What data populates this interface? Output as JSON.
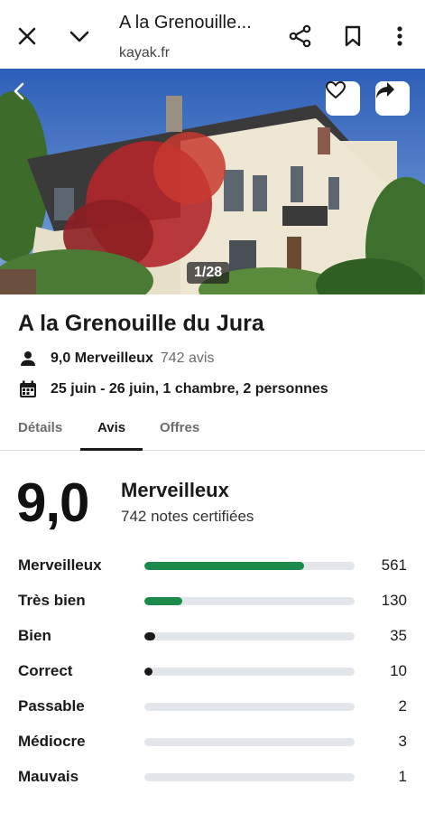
{
  "browser": {
    "title": "A la Grenouille...",
    "url": "kayak.fr",
    "icons": [
      "close-icon",
      "chevron-down-icon",
      "share-icon",
      "bookmark-icon",
      "more-vert-icon"
    ]
  },
  "hero": {
    "counter": "1/28",
    "icons": [
      "back-icon",
      "heart-icon",
      "share-arrow-icon"
    ]
  },
  "hotel": {
    "name": "A la Grenouille du Jura",
    "score_label": "9,0 Merveilleux",
    "reviews_count": "742 avis",
    "dates": "25 juin - 26 juin, 1 chambre, 2 personnes"
  },
  "tabs": [
    {
      "label": "Détails",
      "active": false
    },
    {
      "label": "Avis",
      "active": true
    },
    {
      "label": "Offres",
      "active": false
    }
  ],
  "summary": {
    "score": "9,0",
    "label": "Merveilleux",
    "sub": "742 notes certifiées"
  },
  "colors": {
    "accent_green": "#1b8a4a",
    "dark_fill": "#1a1a1a",
    "track": "#e2e6ea"
  },
  "distribution": [
    {
      "label": "Merveilleux",
      "count": "561",
      "fraction": 0.76,
      "color": "#1b8a4a"
    },
    {
      "label": "Très bien",
      "count": "130",
      "fraction": 0.18,
      "color": "#1b8a4a"
    },
    {
      "label": "Bien",
      "count": "35",
      "fraction": 0.05,
      "color": "#1a1a1a"
    },
    {
      "label": "Correct",
      "count": "10",
      "fraction": 0.01,
      "color": "#1a1a1a"
    },
    {
      "label": "Passable",
      "count": "2",
      "fraction": 0.0,
      "color": "#1a1a1a"
    },
    {
      "label": "Médiocre",
      "count": "3",
      "fraction": 0.0,
      "color": "#1a1a1a"
    },
    {
      "label": "Mauvais",
      "count": "1",
      "fraction": 0.0,
      "color": "#1a1a1a"
    }
  ]
}
